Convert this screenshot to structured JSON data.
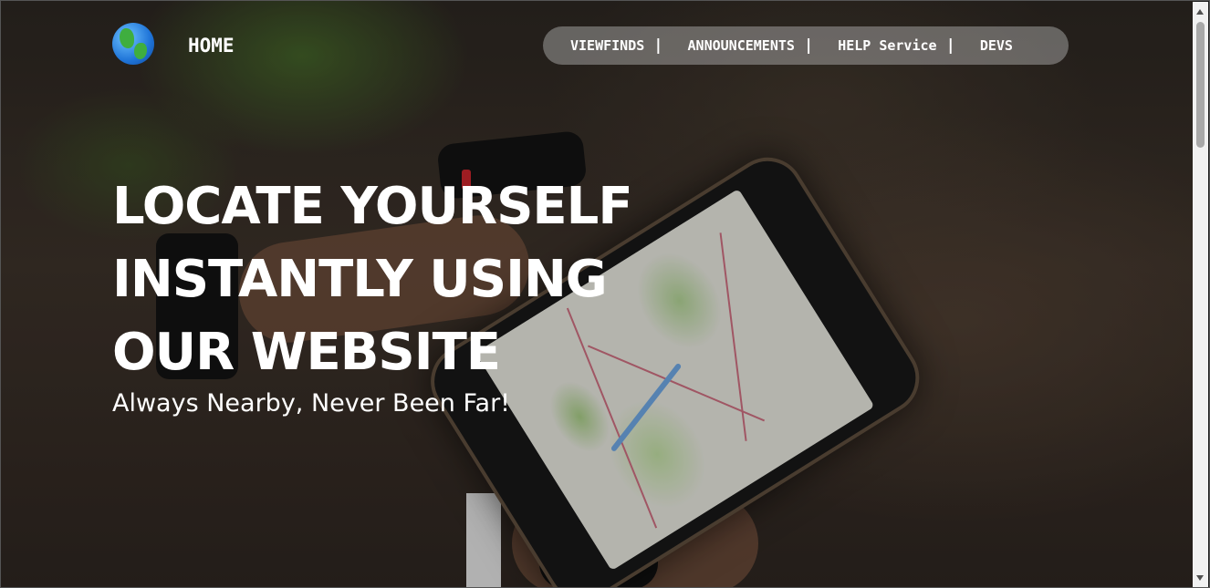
{
  "header": {
    "logo_icon": "globe-icon",
    "home_label": "HOME"
  },
  "nav": {
    "items": [
      {
        "label": "VIEWFINDS"
      },
      {
        "label": "ANNOUNCEMENTS"
      },
      {
        "label": "HELP Service"
      },
      {
        "label": "DEVS"
      }
    ],
    "separator": "|"
  },
  "hero": {
    "headline_lines": [
      "LOCATE YOURSELF",
      "INSTANTLY USING",
      "OUR WEBSITE"
    ],
    "tagline": "Always Nearby, Never Been Far!",
    "background_subject": "hands holding phone with map on bike handlebars"
  },
  "colors": {
    "text": "#ffffff",
    "nav_pill": "#b9b9b9",
    "scrollbar_track": "#f1f1f1",
    "scrollbar_thumb": "#a8a8a8"
  }
}
